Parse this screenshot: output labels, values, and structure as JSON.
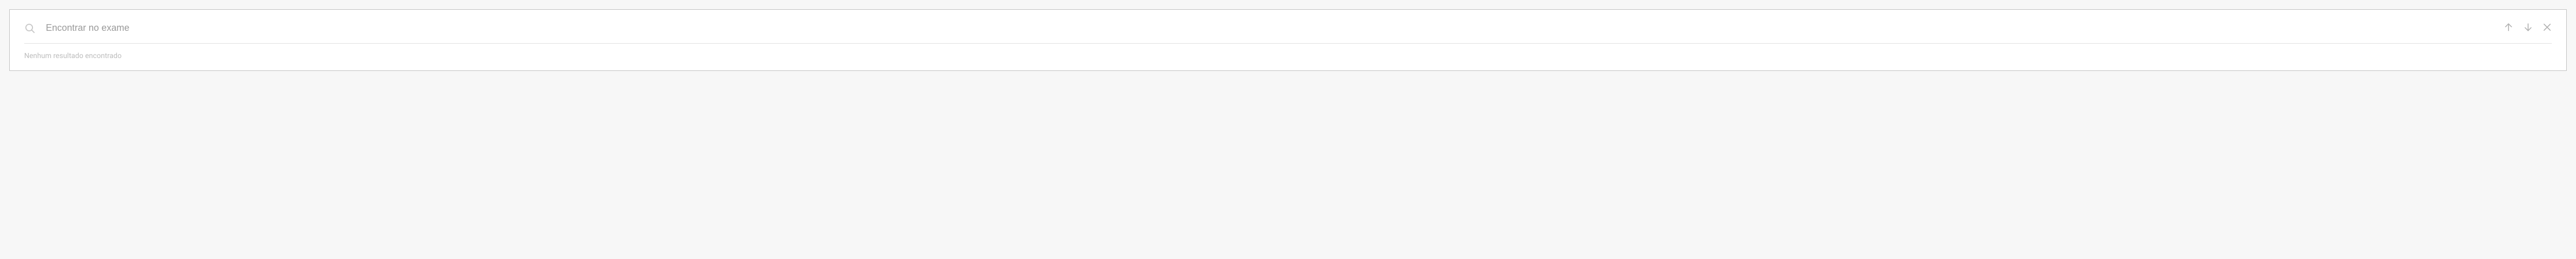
{
  "search": {
    "placeholder": "Encontrar no exame",
    "value": ""
  },
  "status": {
    "message": "Nenhum resultado encontrado"
  },
  "icons": {
    "search": "search-icon",
    "up": "arrow-up-icon",
    "down": "arrow-down-icon",
    "close": "close-icon"
  }
}
